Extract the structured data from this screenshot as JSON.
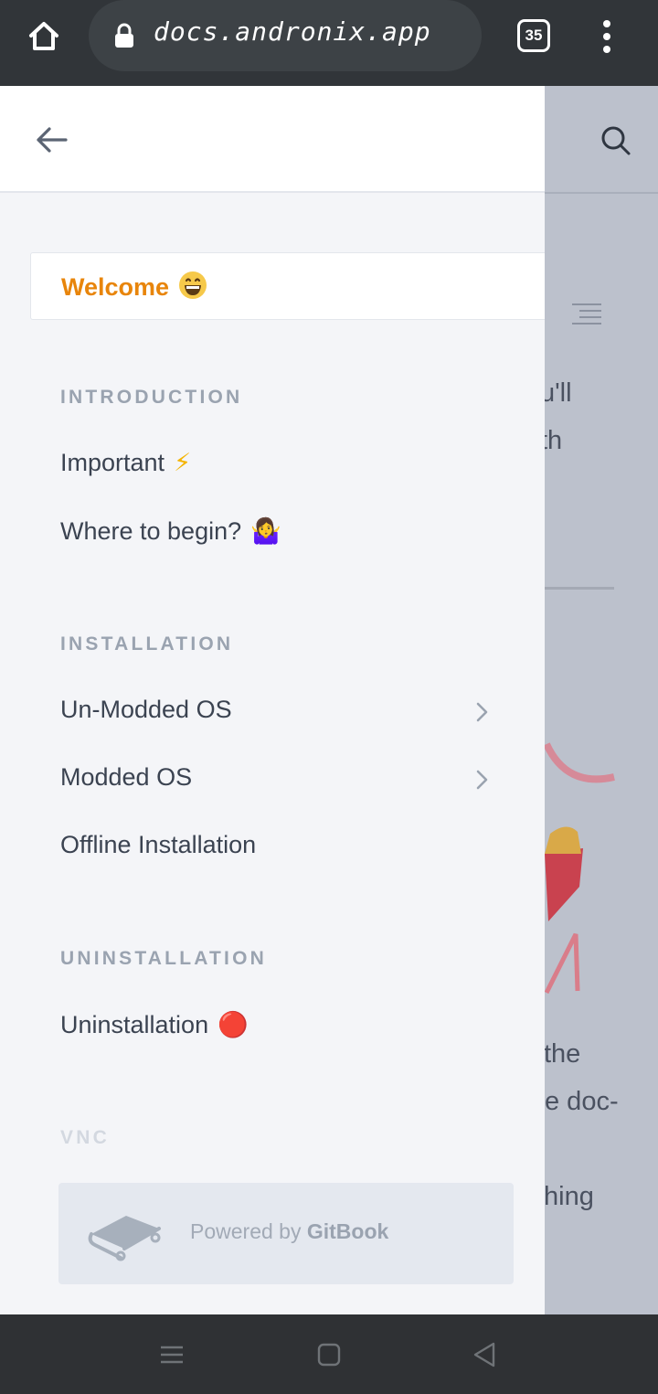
{
  "browser": {
    "url": "docs.andronix.app",
    "tab_count": "35",
    "icons": [
      "home-icon",
      "lock-icon",
      "tabs-icon",
      "more-vert-icon"
    ]
  },
  "background_page": {
    "fragments": [
      "u'll",
      "th",
      "the",
      "e doc-",
      "hing"
    ],
    "icons": [
      "search-icon",
      "table-of-contents-icon"
    ]
  },
  "drawer": {
    "back_icon": "arrow-left-icon",
    "welcome": {
      "label": "Welcome",
      "emoji": "😄"
    },
    "sections": [
      {
        "title": "INTRODUCTION",
        "items": [
          {
            "label": "Important",
            "emoji": "⚡"
          },
          {
            "label": "Where to begin?",
            "emoji": "🤷‍♀️"
          }
        ]
      },
      {
        "title": "INSTALLATION",
        "items": [
          {
            "label": "Un-Modded OS",
            "has_children": true
          },
          {
            "label": "Modded OS",
            "has_children": true
          },
          {
            "label": "Offline Installation"
          }
        ]
      },
      {
        "title": "UNINSTALLATION",
        "items": [
          {
            "label": "Uninstallation",
            "emoji": "🔴"
          }
        ]
      },
      {
        "title": "VNC"
      }
    ],
    "powered_by": {
      "prefix": "Powered by",
      "brand": "GitBook"
    }
  },
  "colors": {
    "accent": "#e8850b",
    "browser_bar": "#313539",
    "drawer_bg": "#f4f5f8",
    "overlay": "#bcc1cc"
  }
}
